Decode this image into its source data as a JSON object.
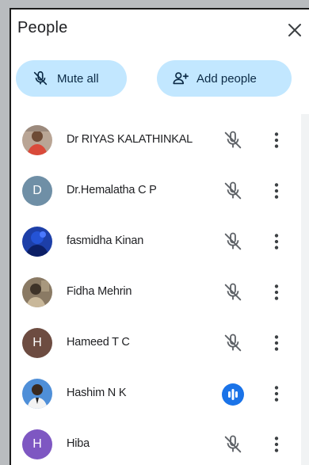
{
  "panel": {
    "title": "People",
    "close_icon": "close-icon"
  },
  "actions": {
    "mute_all_label": "Mute all",
    "mute_all_icon": "mic-off-icon",
    "add_people_label": "Add people",
    "add_people_icon": "person-add-icon"
  },
  "participants": [
    {
      "name": "Dr RIYAS KALATHINKAL",
      "avatar_type": "photo",
      "mic": "muted"
    },
    {
      "name": "Dr.Hemalatha C P",
      "avatar_type": "initial",
      "initial": "D",
      "avatar_color": "#6f8fa6",
      "mic": "muted"
    },
    {
      "name": "fasmidha Kinan",
      "avatar_type": "photo",
      "mic": "muted"
    },
    {
      "name": "Fidha Mehrin",
      "avatar_type": "photo",
      "mic": "muted"
    },
    {
      "name": "Hameed T C",
      "avatar_type": "initial",
      "initial": "H",
      "avatar_color": "#6d4c41",
      "mic": "muted"
    },
    {
      "name": "Hashim N K",
      "avatar_type": "photo",
      "mic": "speaking"
    },
    {
      "name": "Hiba",
      "avatar_type": "initial",
      "initial": "H",
      "avatar_color": "#7e57c2",
      "mic": "muted"
    }
  ],
  "colors": {
    "button_bg": "#c2e7ff",
    "speaking_blue": "#1a73e8",
    "icon_gray": "#5f6368"
  }
}
